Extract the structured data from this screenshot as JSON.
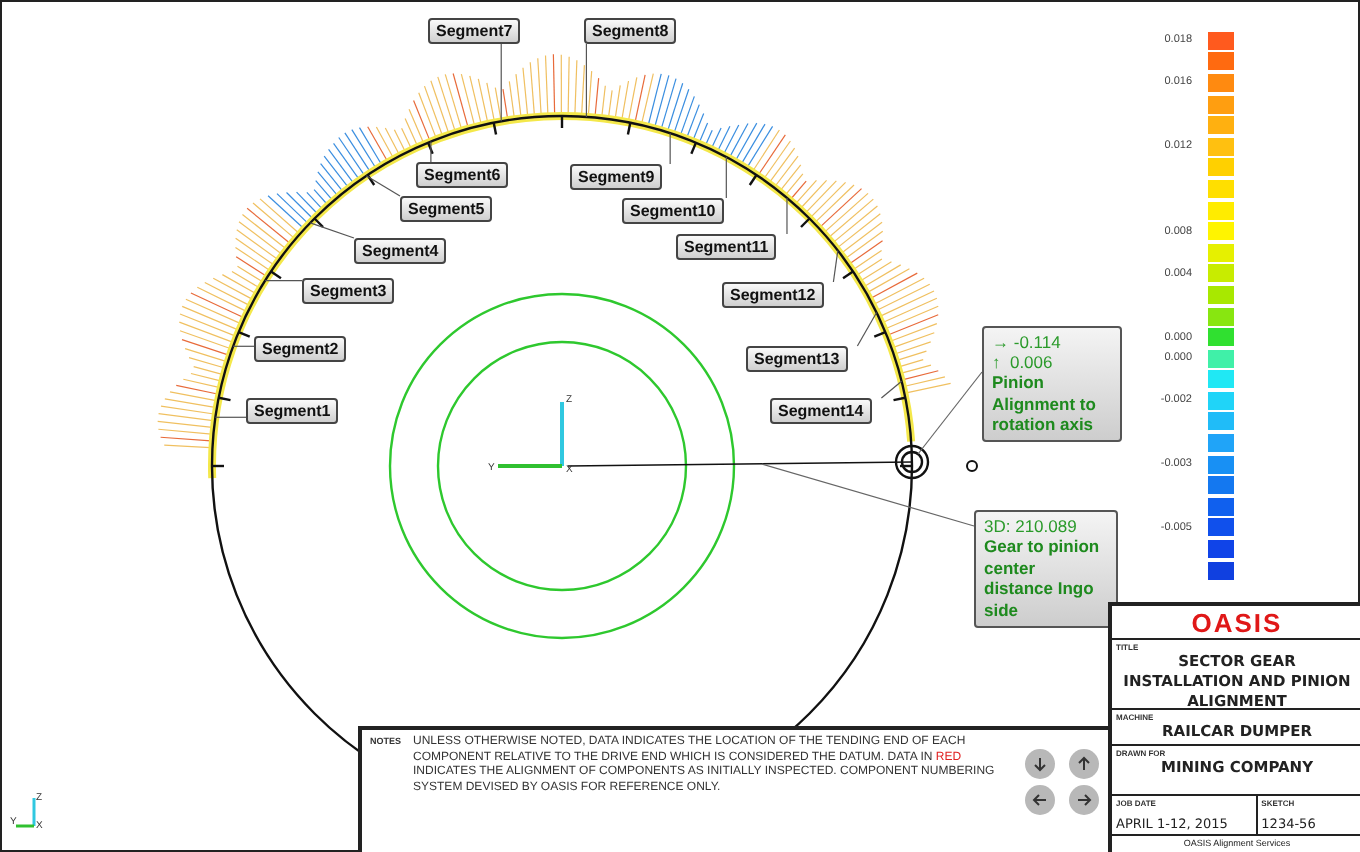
{
  "drawing": {
    "segments": [
      {
        "label": "Segment7"
      },
      {
        "label": "Segment8"
      },
      {
        "label": "Segment6"
      },
      {
        "label": "Segment9"
      },
      {
        "label": "Segment5"
      },
      {
        "label": "Segment10"
      },
      {
        "label": "Segment4"
      },
      {
        "label": "Segment11"
      },
      {
        "label": "Segment3"
      },
      {
        "label": "Segment12"
      },
      {
        "label": "Segment2"
      },
      {
        "label": "Segment13"
      },
      {
        "label": "Segment1"
      },
      {
        "label": "Segment14"
      }
    ],
    "center_axes": {
      "z": "Z",
      "y": "Y",
      "x": "X"
    },
    "callouts": [
      {
        "kind": "alignment",
        "lines": [
          "→ -0.114",
          "↑  0.006"
        ],
        "caption": "Pinion Alignment to rotation axis"
      },
      {
        "kind": "distance",
        "lines": [
          "3D: 210.089"
        ],
        "caption": "Gear to pinion center distance Ingo side"
      }
    ]
  },
  "legend": {
    "swatches": [
      {
        "color": "#ff5a1e",
        "label": "0.018"
      },
      {
        "color": "#ff6a10"
      },
      {
        "color": "#ff8a10",
        "label": "0.016"
      },
      {
        "color": "#ff9e10"
      },
      {
        "color": "#ffb010"
      },
      {
        "color": "#ffc010",
        "label": "0.012"
      },
      {
        "color": "#ffd000"
      },
      {
        "color": "#ffdf00"
      },
      {
        "color": "#ffec00"
      },
      {
        "color": "#fff400",
        "label": "0.008"
      },
      {
        "color": "#e6f000"
      },
      {
        "color": "#c8ec00",
        "label": "0.004"
      },
      {
        "color": "#a8e800"
      },
      {
        "color": "#88e610"
      },
      {
        "color": "#30e030",
        "label": "0.000"
      },
      {
        "color": "#40f0a8",
        "label": "0.000"
      },
      {
        "color": "#20e8f4"
      },
      {
        "color": "#20d4f8",
        "label": "-0.002"
      },
      {
        "color": "#20bcf8"
      },
      {
        "color": "#20a4f8"
      },
      {
        "color": "#1890f4",
        "label": "-0.003"
      },
      {
        "color": "#1478f0"
      },
      {
        "color": "#1060ee"
      },
      {
        "color": "#1050ec",
        "label": "-0.005"
      },
      {
        "color": "#1044e8"
      },
      {
        "color": "#1040e0"
      }
    ]
  },
  "corner_axes": {
    "z": "Z",
    "y": "Y",
    "x": "X"
  },
  "notes": {
    "label": "NOTES",
    "text_before": "UNLESS OTHERWISE NOTED, DATA INDICATES THE LOCATION OF THE TENDING END OF EACH COMPONENT RELATIVE TO THE DRIVE END WHICH IS CONSIDERED THE DATUM. DATA IN ",
    "highlight": "RED",
    "text_after": " INDICATES THE ALIGNMENT OF COMPONENTS AS INITIALLY INSPECTED. COMPONENT NUMBERING SYSTEM DEVISED BY OASIS FOR REFERENCE ONLY."
  },
  "title_block": {
    "logo": "OASIS",
    "title_caption": "TITLE",
    "title": "SECTOR GEAR INSTALLATION AND PINION ALIGNMENT",
    "machine_caption": "MACHINE",
    "machine": "RAILCAR DUMPER",
    "drawn_for_caption": "DRAWN FOR",
    "drawn_for": "MINING COMPANY",
    "job_date_caption": "JOB DATE",
    "job_date": "APRIL 1-12, 2015",
    "sketch_caption": "SKETCH",
    "sketch": "1234-56",
    "footer": "OASIS Alignment Services"
  }
}
